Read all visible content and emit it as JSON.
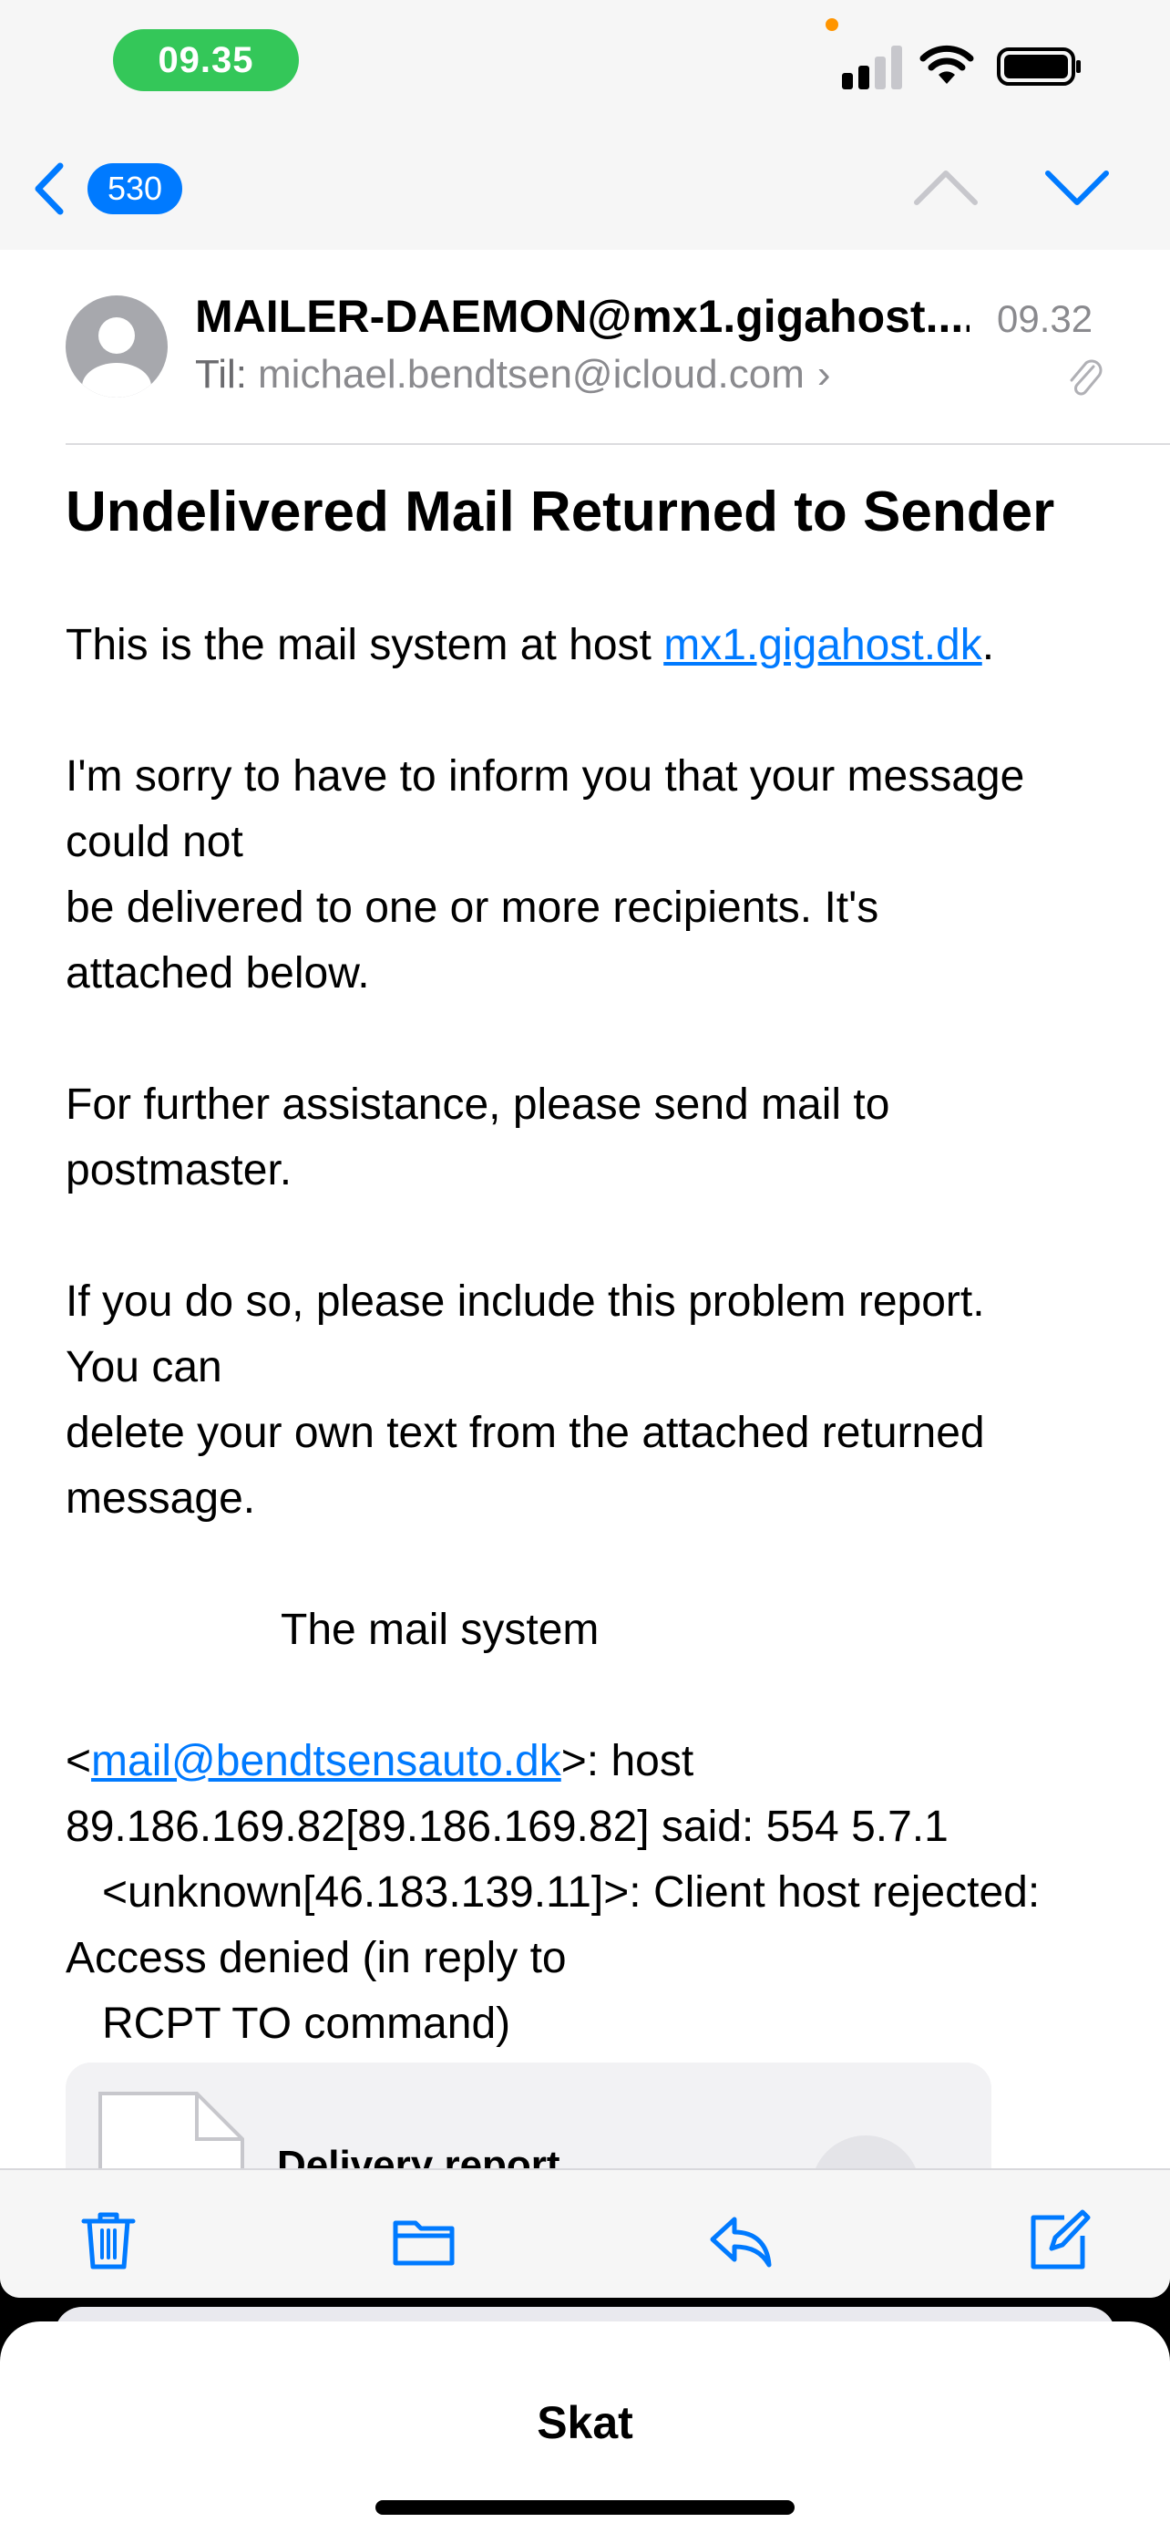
{
  "status_bar": {
    "time": "09.35"
  },
  "nav": {
    "unread_count": "530"
  },
  "message": {
    "sender": "MAILER-DAEMON@mx1.gigahost....",
    "received_time": "09.32",
    "to_label": "Til:",
    "to_address": "michael.bendtsen@icloud.com",
    "to_chevron": "›",
    "subject": "Undelivered Mail Returned to Sender",
    "body": {
      "p1_prefix": "This is the mail system at host ",
      "p1_link": "mx1.gigahost.dk",
      "p1_suffix": ".",
      "p2_line1": "I'm sorry to have to inform you that your message",
      "p2_line2": "could not",
      "p2_line3": "be delivered to one or more recipients. It's",
      "p2_line4": "attached below.",
      "p3_line1": "For further assistance, please send mail to",
      "p3_line2": "postmaster.",
      "p4_line1": "If you do so, please include this problem report.",
      "p4_line2": "You can",
      "p4_line3": "delete your own text from the attached returned",
      "p4_line4": "message.",
      "signature": "The mail system",
      "err_prefix": "<",
      "err_link": "mail@bendtsensauto.dk",
      "err_suffix": ">: host",
      "err_line2": "89.186.169.82[89.186.169.82] said: 554 5.7.1",
      "err_line3": "<unknown[46.183.139.11]>: Client host rejected:",
      "err_line4": "Access denied (in reply to",
      "err_line5": "RCPT TO command)"
    },
    "attachment_name": "Delivery report"
  },
  "sheet": {
    "title": "Skat"
  },
  "colors": {
    "accent": "#007aff",
    "status_green": "#34c759"
  },
  "icons": {
    "back": "chevron-left-icon",
    "previous": "chevron-up-icon",
    "next": "chevron-down-icon",
    "trash": "trash-icon",
    "folder": "folder-icon",
    "reply": "reply-icon",
    "compose": "compose-icon"
  }
}
